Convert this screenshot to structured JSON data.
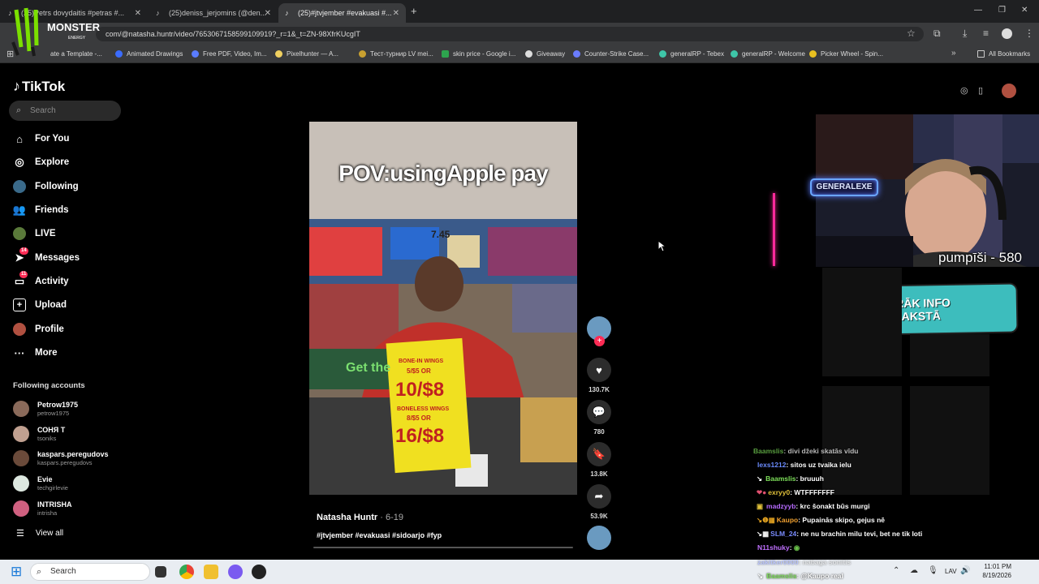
{
  "browser": {
    "tabs": [
      {
        "title": "(25)Petrs dovydaitis #petras #..."
      },
      {
        "title": "(25)deniss_jerjomins (@den..."
      },
      {
        "title": "(25)#jtvjember #evakuasi #..."
      }
    ],
    "url": "com/@natasha.huntr/video/7653067158599109919?_r=1&_t=ZN-98XfrKUcgIT",
    "bookmarks": [
      "ate a Template -...",
      "Animated Drawings",
      "Free PDF, Video, Im...",
      "Pixelhunter — A...",
      "Тест-турнир LV mei...",
      "skin price - Google i...",
      "Giveaway",
      "Counter-Strike Case...",
      "generalRP - Tebex",
      "generalRP - Welcome",
      "Picker Wheel - Spin..."
    ],
    "all_bookmarks": "All Bookmarks",
    "overlay_logo": "MONSTER",
    "overlay_logo_sub": "ENERGY"
  },
  "tiktok": {
    "logo": "TikTok",
    "search_placeholder": "Search",
    "nav": [
      {
        "label": "For You"
      },
      {
        "label": "Explore"
      },
      {
        "label": "Following"
      },
      {
        "label": "Friends"
      },
      {
        "label": "LIVE"
      },
      {
        "label": "Messages",
        "badge": "14"
      },
      {
        "label": "Activity",
        "badge": "11"
      },
      {
        "label": "Upload"
      },
      {
        "label": "Profile"
      },
      {
        "label": "More"
      }
    ],
    "following_title": "Following accounts",
    "accounts": [
      {
        "name": "Petrow1975",
        "handle": "petrow1975"
      },
      {
        "name": "СОНЯ Т",
        "handle": "tsoniks"
      },
      {
        "name": "kaspars.peregudovs",
        "handle": "kaspars.peregudovs"
      },
      {
        "name": "Evie",
        "handle": "techgirlevie"
      },
      {
        "name": "INTRISHA",
        "handle": "intrisha"
      }
    ],
    "view_all": "View all",
    "video": {
      "caption": "POV:usingApple pay",
      "sign_top": "BONE-IN WINGS",
      "sign_mid": "5/$5 OR",
      "sign_price1": "10/$8",
      "sign_mid2": "BONELESS WINGS",
      "sign_mid3": "8/$5 OR",
      "sign_price2": "16/$8",
      "store_banner": "Get the",
      "shelf_price": "7.45",
      "author": "Natasha Huntr",
      "date": "· 6-19",
      "tags": "#jtvjember #evakuasi #sidoarjo #fyp",
      "likes": "130.7K",
      "comments": "780",
      "saves": "13.8K",
      "shares": "53.9K"
    }
  },
  "stream": {
    "sign": "GENERALEXE",
    "counter": "pumpīši - 580",
    "info_button": "VAIRĀK INFO APRAKSTĀ",
    "chat": [
      {
        "user": "Baamslis",
        "msg": ": divi džeki skatās vīdu",
        "color": "#7ee05a"
      },
      {
        "user": "lexs1212",
        "msg": ": sitos uz tvaika ielu",
        "color": "#6b8cff"
      },
      {
        "user": "Baamslis",
        "msg": ": bruuuh",
        "color": "#7ee05a"
      },
      {
        "user": "exryy0",
        "msg": ": WTFFFFFFF",
        "color": "#e0c03a"
      },
      {
        "user": "madzyyb",
        "msg": ": krc šonakt būs murgi",
        "color": "#b66bff"
      },
      {
        "user": "Kaupo",
        "msg": ": Pupainās skipo, gejus nē",
        "color": "#f0a030"
      },
      {
        "user": "SLM_24",
        "msg": ": ne nu brachin milu tevi, bet ne tik loti",
        "color": "#7a8cff"
      },
      {
        "user": "N11shuky",
        "msg": ":",
        "color": "#c070ff"
      },
      {
        "user": "zakitker0000",
        "msg": ": nabaga sonitis",
        "color": "#8fa0ff"
      },
      {
        "user": "Baamslis",
        "msg": ": @Kaupo real",
        "color": "#7ee05a"
      }
    ]
  },
  "taskbar": {
    "search": "Search",
    "lang": "LAV",
    "time": "11:01 PM",
    "date": "8/19/2026"
  }
}
